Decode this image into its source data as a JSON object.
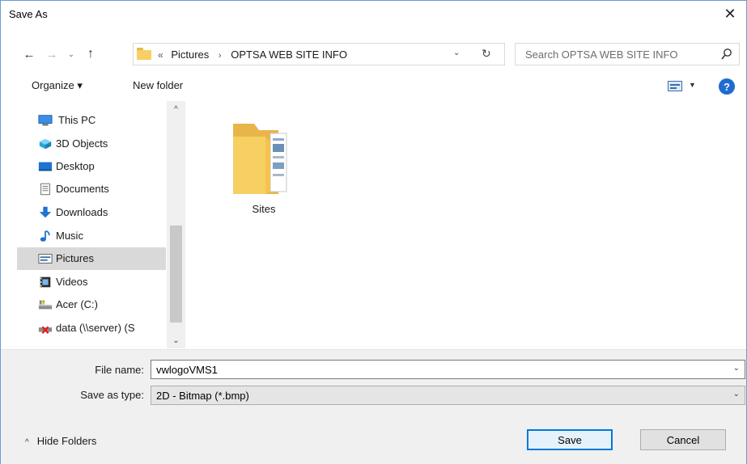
{
  "window": {
    "title": "Save As",
    "close_glyph": "✕"
  },
  "nav": {
    "back": "←",
    "forward": "→",
    "recent": "⌄",
    "up": "↑"
  },
  "address": {
    "overflow": "«",
    "crumbs": [
      "Pictures",
      "OPTSA WEB SITE INFO"
    ],
    "separator": "›",
    "dropdown": "⌄",
    "refresh": "↻"
  },
  "search": {
    "placeholder": "Search OPTSA WEB SITE INFO",
    "icon": "search-icon"
  },
  "toolbar": {
    "organize": "Organize ▾",
    "new_folder": "New folder",
    "view_caret": "▼",
    "help": "?"
  },
  "navigation": {
    "items": [
      {
        "label": "This PC",
        "icon": "computer-icon",
        "selected": false
      },
      {
        "label": "3D Objects",
        "icon": "3d-objects-icon",
        "selected": false
      },
      {
        "label": "Desktop",
        "icon": "desktop-icon",
        "selected": false
      },
      {
        "label": "Documents",
        "icon": "documents-icon",
        "selected": false
      },
      {
        "label": "Downloads",
        "icon": "downloads-icon",
        "selected": false
      },
      {
        "label": "Music",
        "icon": "music-icon",
        "selected": false
      },
      {
        "label": "Pictures",
        "icon": "pictures-icon",
        "selected": true
      },
      {
        "label": "Videos",
        "icon": "videos-icon",
        "selected": false
      },
      {
        "label": "Acer (C:)",
        "icon": "drive-icon",
        "selected": false
      },
      {
        "label": "data (\\\\server) (S",
        "icon": "network-drive-disconnected-icon",
        "selected": false
      }
    ],
    "scroll_up": "^",
    "scroll_down": "⌄"
  },
  "content": {
    "items": [
      {
        "name": "Sites",
        "type": "folder"
      }
    ]
  },
  "form": {
    "file_name_label": "File name:",
    "file_name_value": "vwlogoVMS1",
    "save_type_label": "Save as type:",
    "save_type_value": "2D - Bitmap (*.bmp)",
    "dropdown_glyph": "⌄"
  },
  "footer": {
    "hide_folders": "Hide Folders",
    "hide_chevron": "^",
    "save_button": "Save",
    "cancel_button": "Cancel"
  },
  "colors": {
    "accent": "#0078d7",
    "selected_bg": "#d9d9d9",
    "folder": "#f7cf62",
    "help": "#1f6bd1"
  }
}
